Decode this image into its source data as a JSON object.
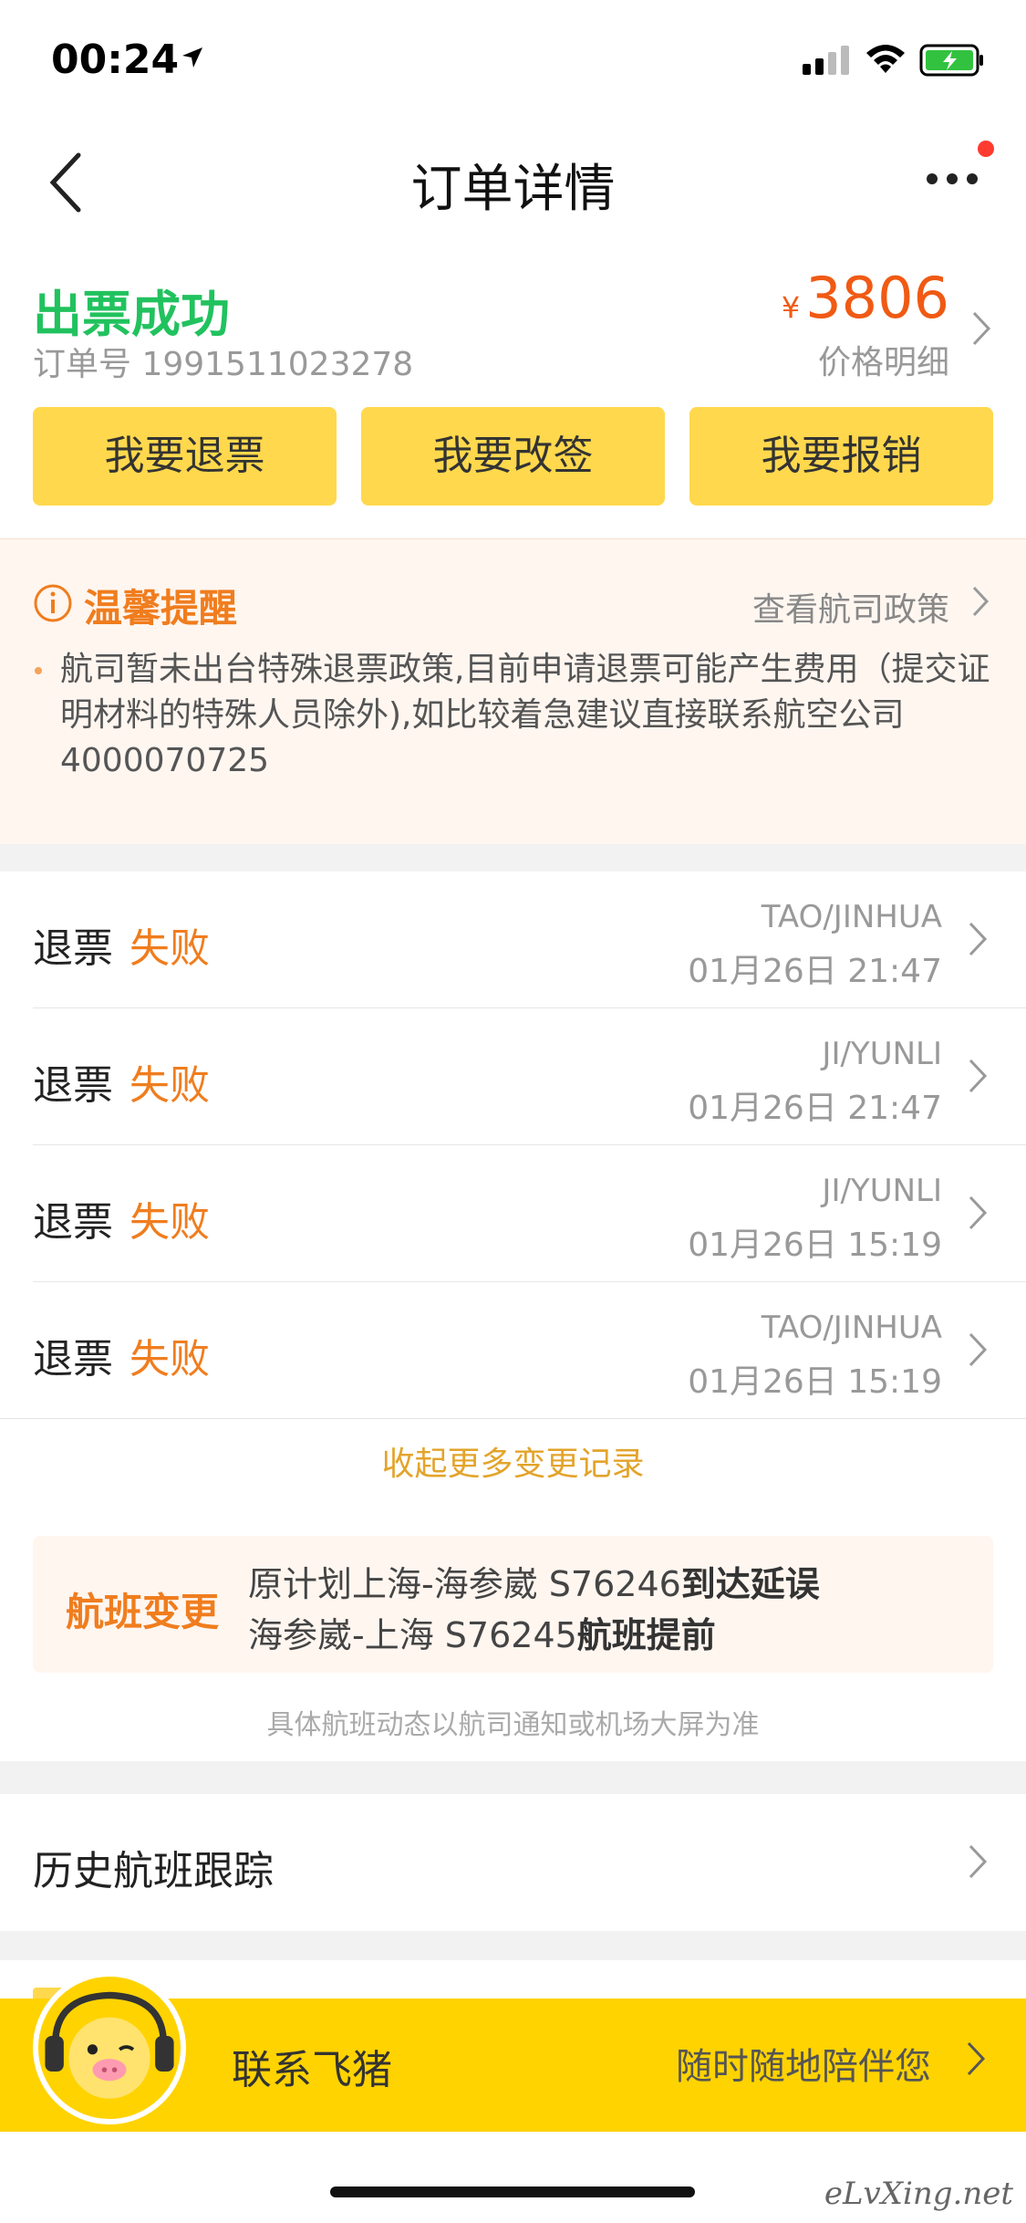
{
  "status_bar": {
    "time": "00:24"
  },
  "nav": {
    "title": "订单详情"
  },
  "order": {
    "status": "出票成功",
    "order_no": "订单号 1991511023278",
    "currency": "¥",
    "price": "3806",
    "price_detail": "价格明细",
    "buttons": [
      "我要退票",
      "我要改签",
      "我要报销"
    ]
  },
  "notice": {
    "title": "温馨提醒",
    "link": "查看航司政策",
    "text": "航司暂未出台特殊退票政策,目前申请退票可能产生费用（提交证明材料的特殊人员除外),如比较着急建议直接联系航空公司4000070725"
  },
  "records": [
    {
      "type": "退票",
      "result": "失败",
      "name": "TAO/JINHUA",
      "time": "01月26日 21:47"
    },
    {
      "type": "退票",
      "result": "失败",
      "name": "JI/YUNLI",
      "time": "01月26日 21:47"
    },
    {
      "type": "退票",
      "result": "失败",
      "name": "JI/YUNLI",
      "time": "01月26日 15:19"
    },
    {
      "type": "退票",
      "result": "失败",
      "name": "TAO/JINHUA",
      "time": "01月26日 15:19"
    }
  ],
  "collapse_link": "收起更多变更记录",
  "flight_change": {
    "tag": "航班变更",
    "line1_prefix": "原计划上海-海参崴 S76246",
    "line1_bold": "到达延误",
    "line2_prefix": "海参崴-上海 S76245",
    "line2_bold": "航班提前",
    "note": "具体航班动态以航司通知或机场大屏为准"
  },
  "history": {
    "label": "历史航班跟踪"
  },
  "contact": {
    "label": "联系飞猪",
    "subtitle": "随时随地陪伴您"
  },
  "watermark": "eLvXing.net",
  "colors": {
    "success": "#21c25e",
    "accent": "#f07d1e",
    "button": "#ffd84d",
    "contact_bar": "#ffd300"
  },
  "icons": [
    "location-arrow-icon",
    "signal-icon",
    "wifi-icon",
    "battery-charging-icon",
    "back-chevron-icon",
    "more-dots-icon",
    "info-circle-icon",
    "chevron-right-icon",
    "mascot-avatar-icon"
  ]
}
